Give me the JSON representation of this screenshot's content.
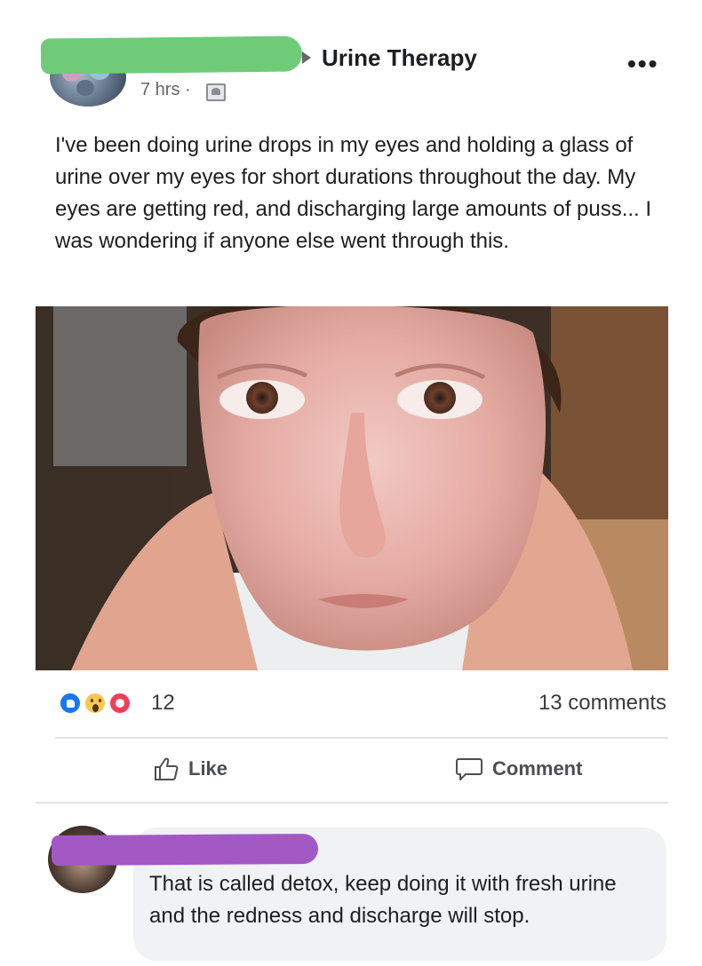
{
  "post": {
    "group_name": "Urine Therapy",
    "timestamp": "7 hrs · ",
    "more_icon": "more-dots-icon",
    "privacy_icon": "friends-audience-icon",
    "text": "I've been doing urine drops in my eyes and holding a glass of urine over my eyes for short durations throughout the day. My eyes are getting red, and discharging large amounts of puss... I was wondering if anyone else went through this."
  },
  "reactions": {
    "icons": [
      "like-reaction-icon",
      "wow-reaction-icon",
      "love-reaction-icon"
    ],
    "count": "12",
    "comments_count": "13 comments"
  },
  "actions": {
    "like_label": "Like",
    "comment_label": "Comment"
  },
  "comment": {
    "text": "That is called detox, keep doing it with fresh urine and the redness and discharge will stop."
  },
  "colors": {
    "name_redaction": "#6fcb78",
    "commenter_redaction": "#a259c4",
    "like_blue": "#1877f2",
    "love_red": "#f33e58",
    "wow_yellow": "#f7c84b"
  }
}
